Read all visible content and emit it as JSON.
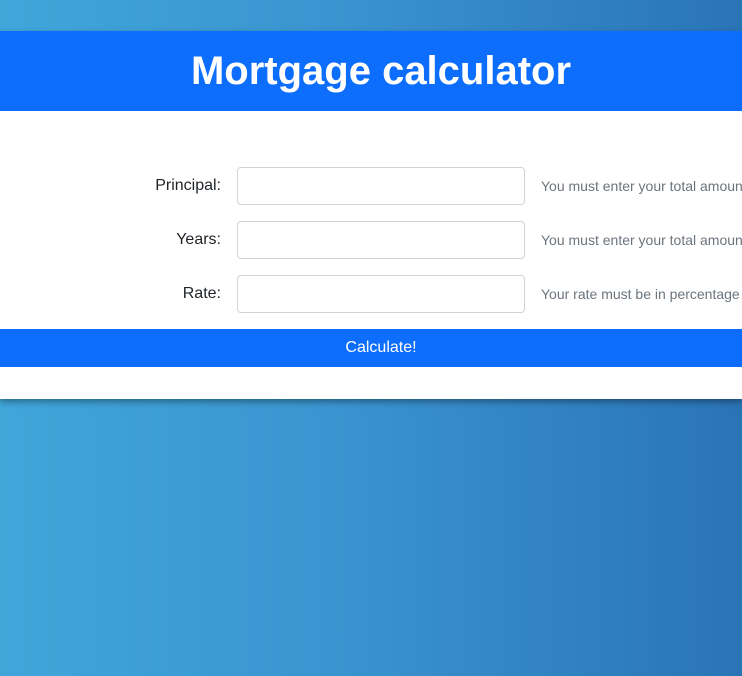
{
  "header": {
    "title": "Mortgage calculator"
  },
  "form": {
    "principal": {
      "label": "Principal:",
      "value": "",
      "placeholder": "",
      "help": "You must enter your total amount"
    },
    "years": {
      "label": "Years:",
      "value": "",
      "placeholder": "",
      "help": "You must enter your total amount"
    },
    "rate": {
      "label": "Rate:",
      "value": "",
      "placeholder": "",
      "help": "Your rate must be in percentage"
    },
    "submit_label": "Calculate!"
  },
  "colors": {
    "primary": "#0d6efd",
    "background_gradient_start": "#40a6da",
    "background_gradient_end": "#2a74b6",
    "help_text": "#6c757d"
  }
}
